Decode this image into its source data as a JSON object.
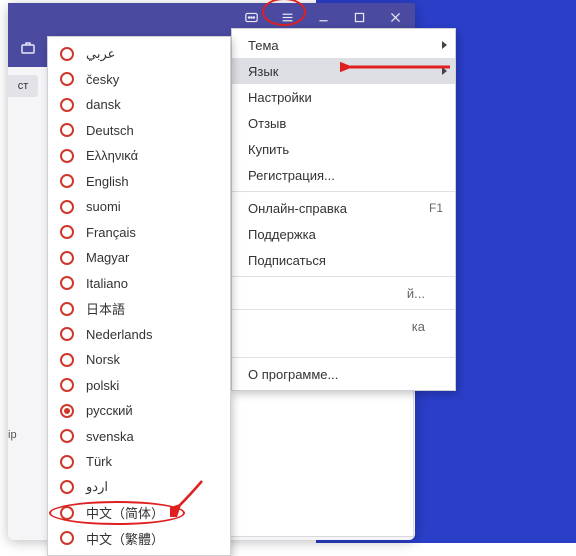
{
  "titlebar": {
    "stub1": "ст",
    "stub2": "ір"
  },
  "menu": {
    "items": [
      {
        "label": "Тема",
        "arrow": true
      },
      {
        "label": "Язык",
        "arrow": true,
        "highlighted": true
      },
      {
        "label": "Настройки"
      },
      {
        "label": "Отзыв"
      },
      {
        "label": "Купить"
      },
      {
        "label": "Регистрация..."
      },
      {
        "sep": true
      },
      {
        "label": "Онлайн-справка",
        "shortcut": "F1"
      },
      {
        "label": "Поддержка"
      },
      {
        "label": "Подписаться"
      },
      {
        "sep": true
      },
      {
        "label": "й...",
        "fragment": true
      },
      {
        "sep": true
      },
      {
        "label": "ка",
        "fragment": true
      },
      {
        "sep": true,
        "tall": true
      },
      {
        "label": "О программе..."
      }
    ]
  },
  "languages": [
    {
      "label": "عربي"
    },
    {
      "label": "česky"
    },
    {
      "label": "dansk"
    },
    {
      "label": "Deutsch"
    },
    {
      "label": "Ελληνικά"
    },
    {
      "label": "English"
    },
    {
      "label": "suomi"
    },
    {
      "label": "Français"
    },
    {
      "label": "Magyar"
    },
    {
      "label": "Italiano"
    },
    {
      "label": "日本語"
    },
    {
      "label": "Nederlands"
    },
    {
      "label": "Norsk"
    },
    {
      "label": "polski"
    },
    {
      "label": "русский",
      "selected": true
    },
    {
      "label": "svenska"
    },
    {
      "label": "Türk"
    },
    {
      "label": "اردو"
    },
    {
      "label": "中文（简体）"
    },
    {
      "label": "中文（繁體）"
    }
  ]
}
